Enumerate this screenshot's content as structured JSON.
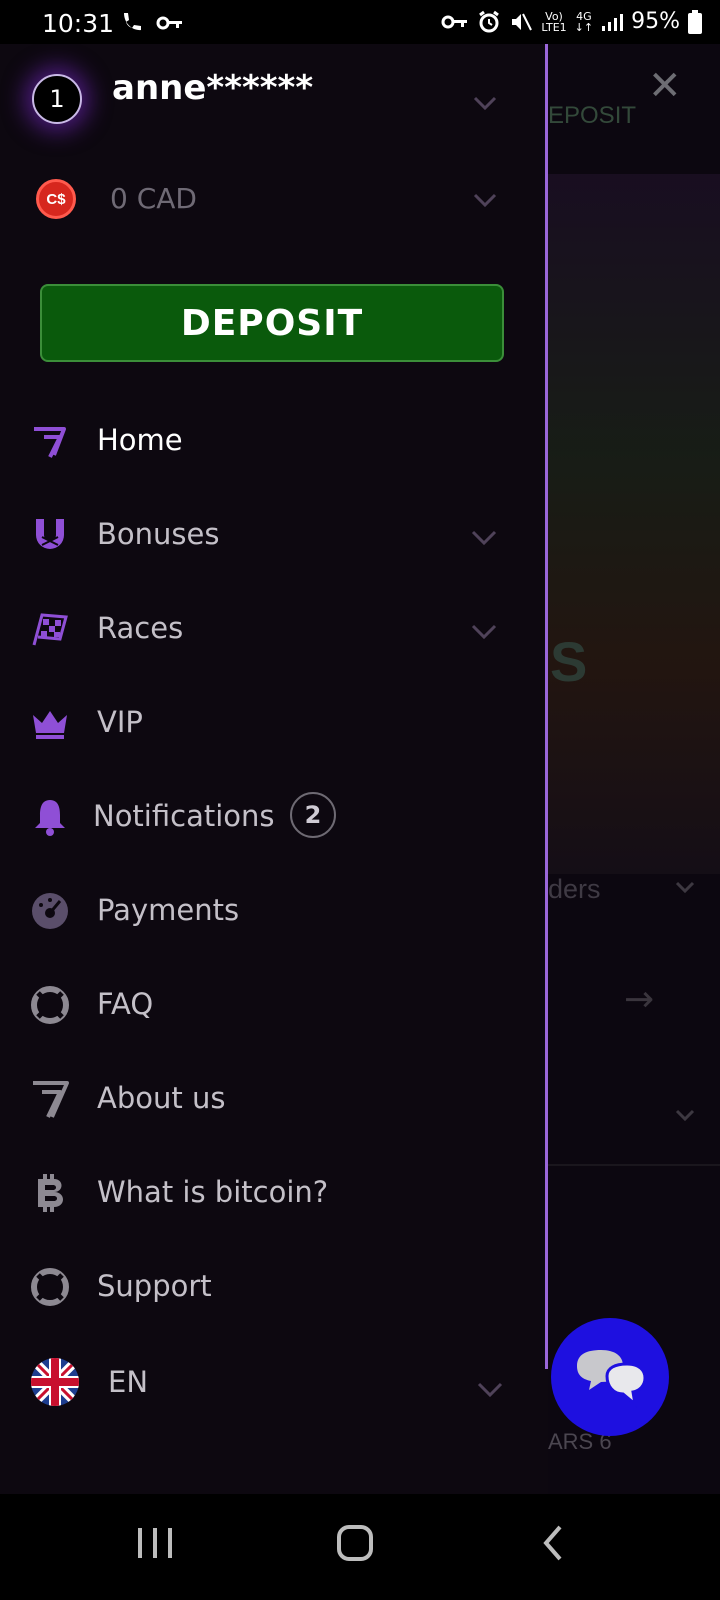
{
  "status_bar": {
    "time": "10:31",
    "battery": "95%",
    "network_top": "Vo)",
    "network_bottom": "LTE1",
    "data_top": "4G",
    "data_bottom": "↓↑"
  },
  "background": {
    "deposit_fragment": "EPOSIT",
    "close_glyph": "✕",
    "fragment_ders": "ders",
    "fragment_s": "S",
    "arrow_glyph": "→",
    "fragment_ars": "ARS 6"
  },
  "account": {
    "level": "1",
    "username": "anne******"
  },
  "balance": {
    "currency_symbol": "C$",
    "amount": "0 CAD"
  },
  "deposit_button": {
    "label": "DEPOSIT"
  },
  "menu": [
    {
      "label": "Home",
      "icon": "seven-logo-icon"
    },
    {
      "label": "Bonuses",
      "icon": "horseshoe-icon"
    },
    {
      "label": "Races",
      "icon": "checkered-flag-icon"
    },
    {
      "label": "VIP",
      "icon": "crown-icon"
    },
    {
      "label": "Notifications",
      "icon": "bell-icon",
      "badge": "2"
    },
    {
      "label": "Payments",
      "icon": "payment-chip-icon"
    },
    {
      "label": "FAQ",
      "icon": "lifebuoy-icon"
    },
    {
      "label": "About us",
      "icon": "seven-outline-icon"
    },
    {
      "label": "What is bitcoin?",
      "icon": "bitcoin-icon"
    },
    {
      "label": "Support",
      "icon": "support-lifebuoy-icon"
    }
  ],
  "language": {
    "label": "EN",
    "icon": "uk-flag-icon"
  },
  "colors": {
    "accent_purple": "#8f4fd6",
    "deposit_green": "#0a5a0c",
    "chat_blue": "#1e10e0"
  }
}
